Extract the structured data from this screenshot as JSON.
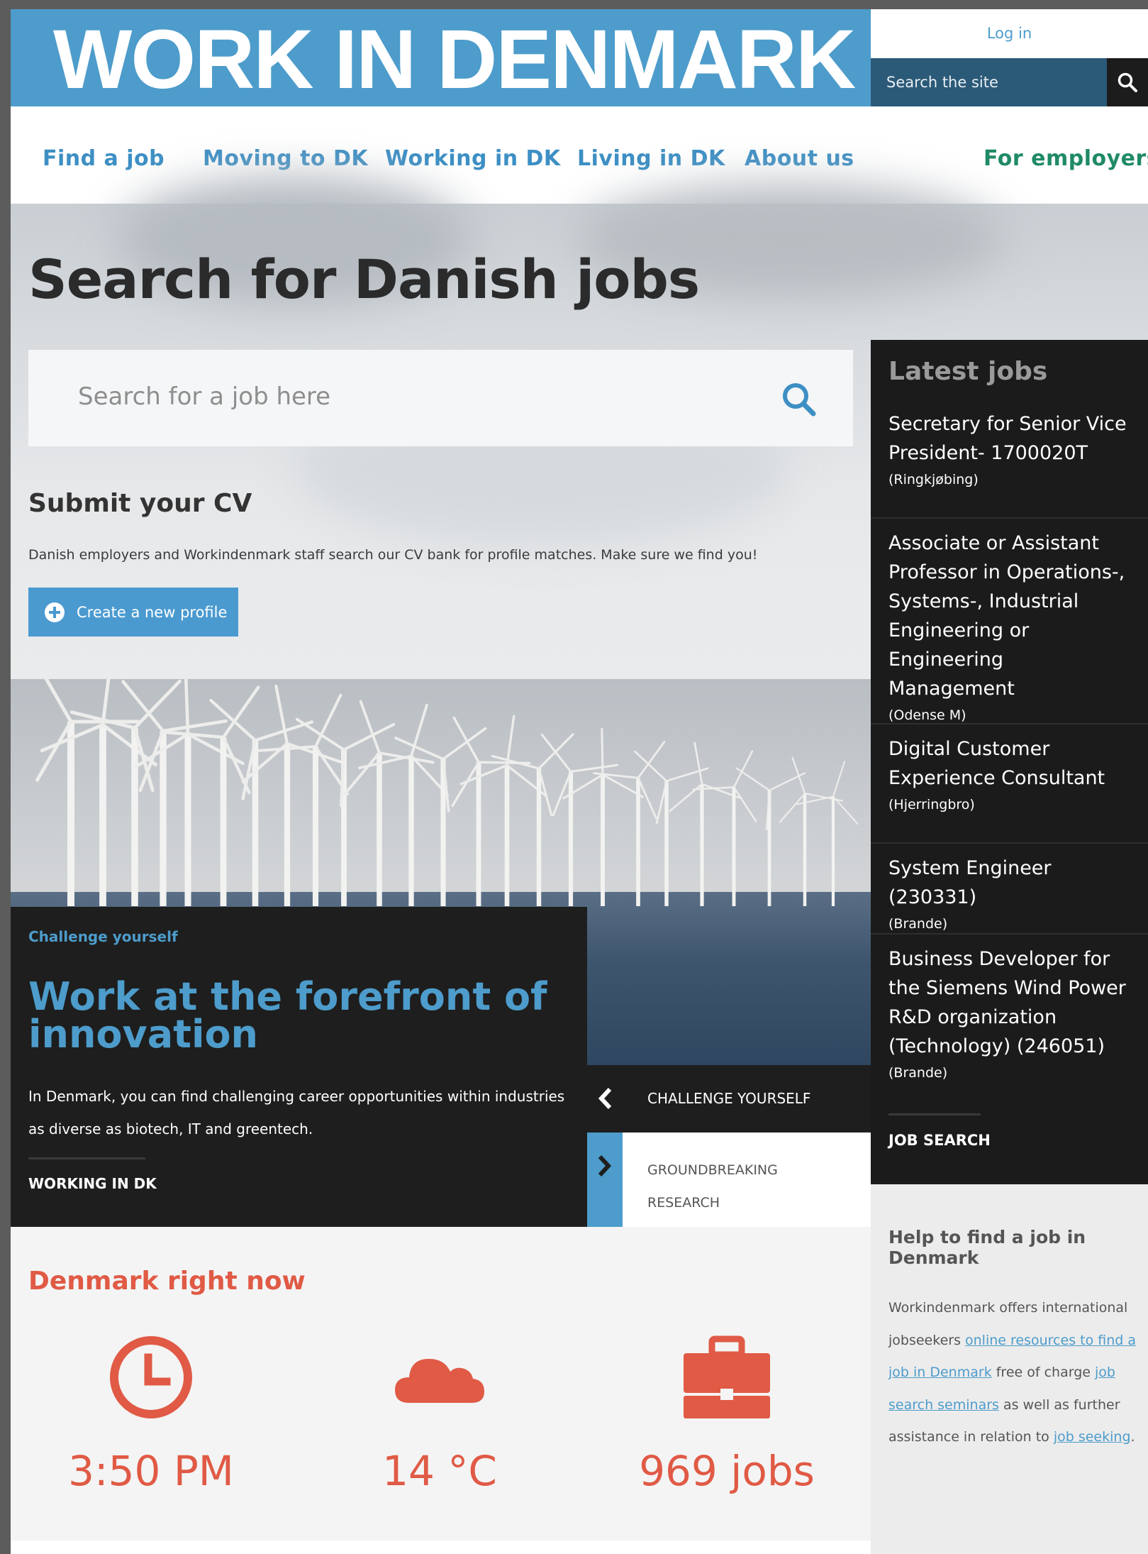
{
  "header": {
    "brand": "WORK IN DENMARK",
    "login": "Log in",
    "site_search_placeholder": "Search the site"
  },
  "nav": {
    "items": [
      "Find a job",
      "Moving to DK",
      "Working in DK",
      "Living in DK",
      "About us"
    ],
    "employers": "For employers"
  },
  "hero": {
    "title": "Search for Danish jobs",
    "search_placeholder": "Search for a job here",
    "cv_title": "Submit your CV",
    "cv_description": "Danish employers and Workindenmark staff search our CV bank for profile matches. Make sure we find you!",
    "cv_button": "Create a new profile"
  },
  "latest_jobs": {
    "title": "Latest jobs",
    "items": [
      {
        "title": "Secretary for Senior Vice President- 1700020T",
        "location": "(Ringkjøbing)"
      },
      {
        "title": "Associate or Assistant Professor in Operations-, Systems-, Industrial Engineering or Engineering Management",
        "location": "(Odense M)"
      },
      {
        "title": "Digital Customer Experience Consultant",
        "location": "(Hjerringbro)"
      },
      {
        "title": "System Engineer (230331)",
        "location": "(Brande)"
      },
      {
        "title": "Business Developer for the Siemens Wind Power R&D organization (Technology) (246051)",
        "location": "(Brande)"
      }
    ],
    "link": "JOB SEARCH"
  },
  "feature": {
    "kicker": "Challenge yourself",
    "title": "Work at the forefront of innovation",
    "text": "In Denmark, you can find challenging career opportunities within industries as diverse as biotech, IT and greentech.",
    "link": "WORKING IN DK",
    "prev_tab": "CHALLENGE YOURSELF",
    "next_tab": "GROUNDBREAKING RESEARCH"
  },
  "now": {
    "title": "Denmark right now",
    "stats": [
      {
        "icon": "clock-icon",
        "value": "3:50 PM"
      },
      {
        "icon": "cloud-icon",
        "value": "14 °C"
      },
      {
        "icon": "briefcase-icon",
        "value": "969 jobs"
      }
    ]
  },
  "help": {
    "title": "Help to find a job in Denmark",
    "text_1": "Workindenmark offers international jobseekers ",
    "link_1": "online resources to find a job in Denmark",
    "text_2": " free of charge ",
    "link_2": "job search seminars",
    "text_3": " as well as further assistance in relation to ",
    "link_3": "job seeking",
    "text_4": "."
  },
  "colors": {
    "brand_blue": "#4d9ccb",
    "employers_green": "#1f8a66",
    "accent_red": "#e05a45",
    "dark_panel": "#1b1b1b"
  }
}
